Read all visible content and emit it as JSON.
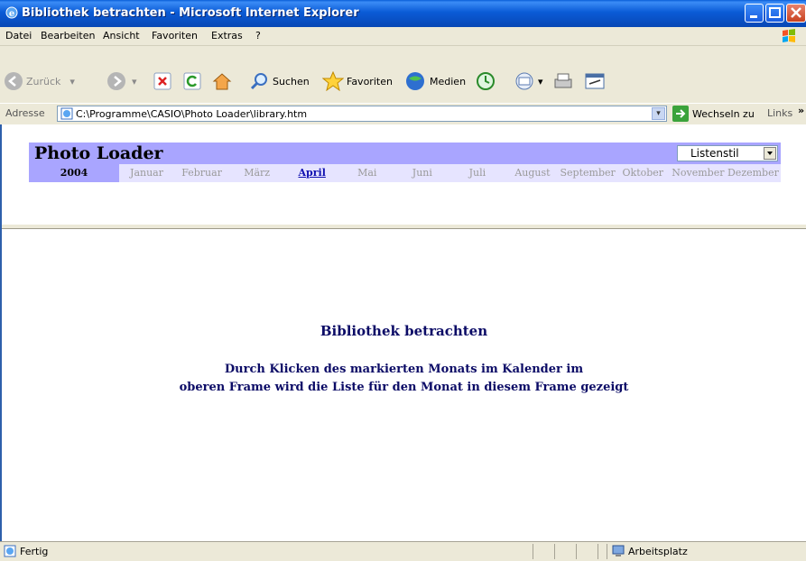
{
  "window": {
    "title": "Bibliothek betrachten - Microsoft Internet Explorer"
  },
  "menu": [
    "Datei",
    "Bearbeiten",
    "Ansicht",
    "Favoriten",
    "Extras",
    "?"
  ],
  "toolbar": {
    "back": "Zurück",
    "search": "Suchen",
    "favorites": "Favoriten",
    "media": "Medien"
  },
  "address": {
    "label": "Adresse",
    "url": "C:\\Programme\\CASIO\\Photo Loader\\library.htm",
    "go": "Wechseln zu",
    "links": "Links"
  },
  "photoloader": {
    "title": "Photo Loader",
    "style_select": "Listenstil",
    "year": "2004",
    "months": [
      "Januar",
      "Februar",
      "März",
      "April",
      "Mai",
      "Juni",
      "Juli",
      "August",
      "September",
      "Oktober",
      "November",
      "Dezember"
    ],
    "active_month": "April"
  },
  "main": {
    "heading": "Bibliothek betrachten",
    "desc_line1": "Durch Klicken des markierten Monats im Kalender im",
    "desc_line2": "oberen Frame wird die Liste für den Monat in diesem Frame gezeigt"
  },
  "status": {
    "left": "Fertig",
    "zone": "Arbeitsplatz"
  },
  "colors": {
    "header_bg": "#A9A5FF",
    "month_bg": "#E6E4FF",
    "text_dark_blue": "#0B0B66",
    "active_month": "#1010B0"
  }
}
